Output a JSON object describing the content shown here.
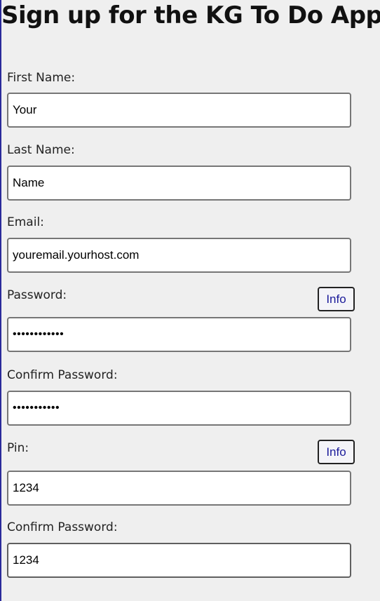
{
  "page": {
    "title": "Sign up for the KG To Do App!"
  },
  "form": {
    "first_name": {
      "label": "First Name:",
      "value": "Your"
    },
    "last_name": {
      "label": "Last Name:",
      "value": "Name"
    },
    "email": {
      "label": "Email:",
      "value": "youremail.yourhost.com"
    },
    "password": {
      "label": "Password:",
      "value": "************",
      "info_label": "Info"
    },
    "confirm_password": {
      "label": "Confirm Password:",
      "value": "***********"
    },
    "pin": {
      "label": "Pin:",
      "value": "1234",
      "info_label": "Info"
    },
    "confirm_pin": {
      "label": "Confirm Password:",
      "value": "1234"
    }
  },
  "colors": {
    "background": "#efefef",
    "info_text": "#1a1a9a",
    "field_border": "#767676"
  }
}
